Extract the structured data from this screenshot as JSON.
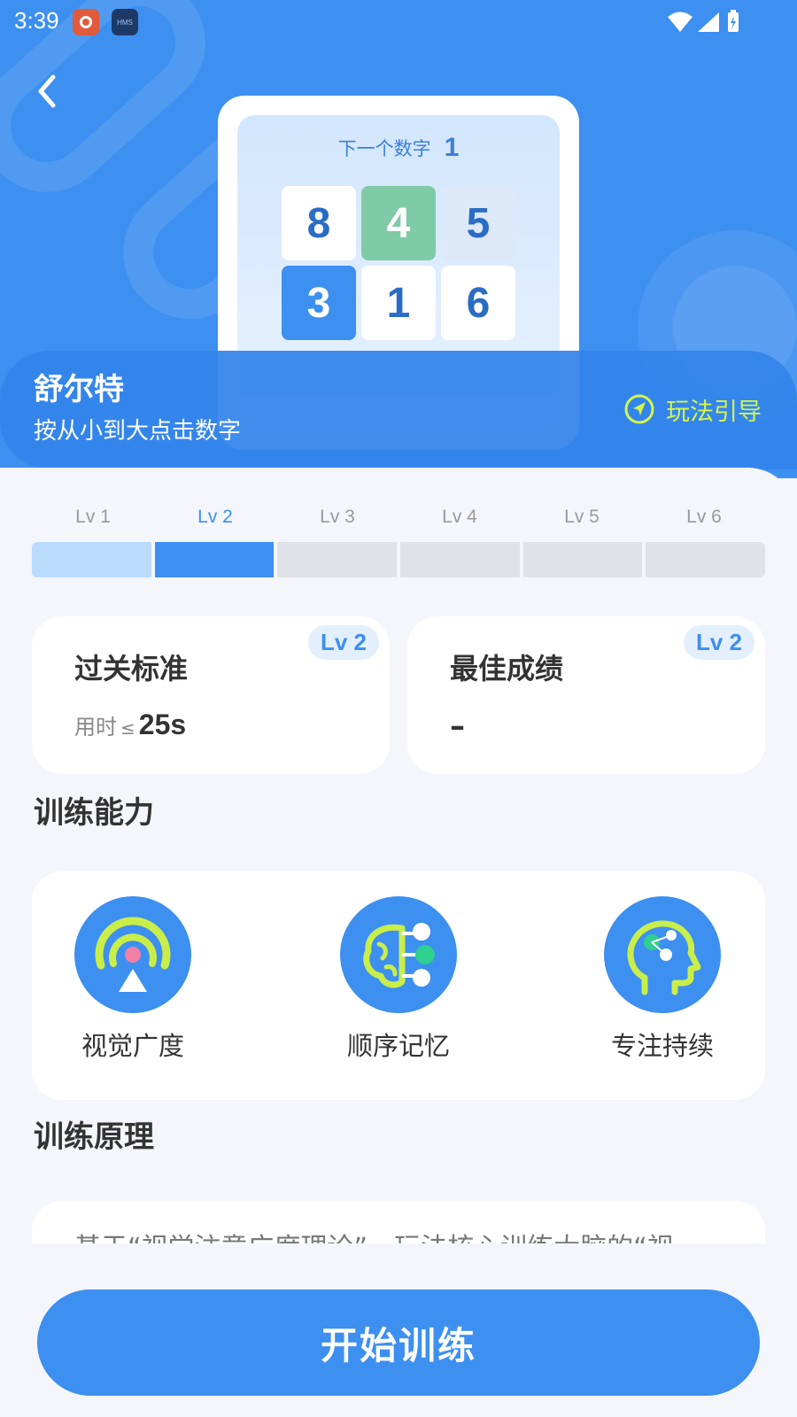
{
  "status_bar": {
    "time": "3:39",
    "app2_label": "HMS"
  },
  "preview": {
    "next_label": "下一个数字",
    "next_number": "1",
    "tiles": [
      "8",
      "4",
      "5",
      "3",
      "1",
      "6"
    ]
  },
  "game": {
    "title": "舒尔特",
    "subtitle": "按从小到大点击数字",
    "guide_label": "玩法引导"
  },
  "levels": {
    "labels": [
      "Lv 1",
      "Lv 2",
      "Lv 3",
      "Lv 4",
      "Lv 5",
      "Lv 6"
    ],
    "current": "Lv 2"
  },
  "pass_card": {
    "title": "过关标准",
    "badge": "Lv 2",
    "label": "用时",
    "comparator": "≤",
    "value": "25s"
  },
  "best_card": {
    "title": "最佳成绩",
    "badge": "Lv 2",
    "value": "–"
  },
  "abilities": {
    "title": "训练能力",
    "items": [
      {
        "label": "视觉广度",
        "icon": "radar-icon"
      },
      {
        "label": "顺序记忆",
        "icon": "brain-network-icon"
      },
      {
        "label": "专注持续",
        "icon": "head-focus-icon"
      }
    ]
  },
  "principle": {
    "title": "训练原理",
    "text": "基于“视觉注意广度理论”，玩法核心训练大脑的“视"
  },
  "start_button": "开始训练",
  "colors": {
    "primary": "#3d8ff0",
    "accent_lime": "#d5f54a",
    "tile_green": "#7fcaa7",
    "background": "#f4f6fb"
  }
}
